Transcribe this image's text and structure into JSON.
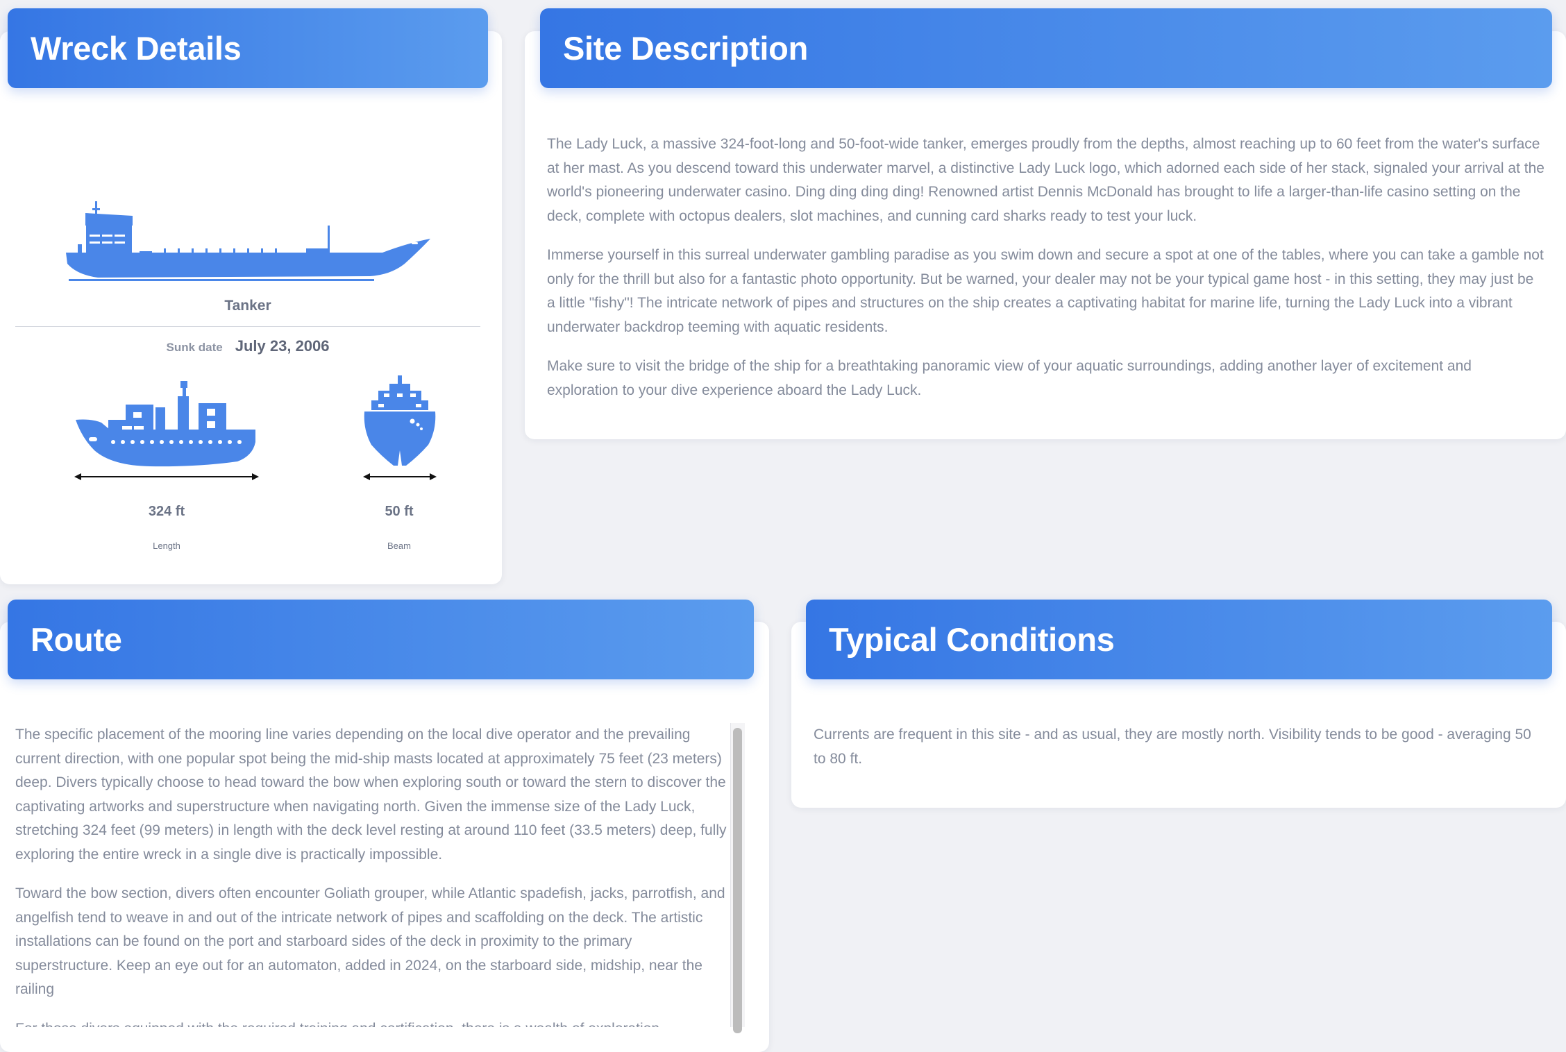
{
  "wreck_details": {
    "title": "Wreck Details",
    "ship_type": "Tanker",
    "sunk_date_label": "Sunk date",
    "sunk_date": "July 23, 2006",
    "length_value": "324 ft",
    "length_label": "Length",
    "beam_value": "50 ft",
    "beam_label": "Beam"
  },
  "site_description": {
    "title": "Site Description",
    "paragraphs": [
      "The Lady Luck, a massive 324-foot-long and 50-foot-wide tanker, emerges proudly from the depths, almost reaching up to 60 feet from the water's surface at her mast. As you descend toward this underwater marvel, a distinctive Lady Luck logo, which adorned each side of her stack, signaled your arrival at the world's pioneering underwater casino. Ding ding ding ding! Renowned artist Dennis McDonald has brought to life a larger-than-life casino setting on the deck, complete with octopus dealers, slot machines, and cunning card sharks ready to test your luck.",
      "Immerse yourself in this surreal underwater gambling paradise as you swim down and secure a spot at one of the tables, where you can take a gamble not only for the thrill but also for a fantastic photo opportunity. But be warned, your dealer may not be your typical game host - in this setting, they may just be a little \"fishy\"! The intricate network of pipes and structures on the ship creates a captivating habitat for marine life, turning the Lady Luck into a vibrant underwater backdrop teeming with aquatic residents.",
      "Make sure to visit the bridge of the ship for a breathtaking panoramic view of your aquatic surroundings, adding another layer of excitement and exploration to your dive experience aboard the Lady Luck."
    ]
  },
  "route": {
    "title": "Route",
    "paragraphs": [
      "The specific placement of the mooring line varies depending on the local dive operator and the prevailing current direction, with one popular spot being the mid-ship masts located at approximately 75 feet (23 meters) deep. Divers typically choose to head toward the bow when exploring south or toward the stern to discover the captivating artworks and superstructure when navigating north. Given the immense size of the Lady Luck, stretching 324 feet (99 meters) in length with the deck level resting at around 110 feet (33.5 meters) deep, fully exploring the entire wreck in a single dive is practically impossible.",
      "Toward the bow section, divers often encounter Goliath grouper, while Atlantic spadefish, jacks, parrotfish, and angelfish tend to weave in and out of the intricate network of pipes and scaffolding on the deck. The artistic installations can be found on the port and starboard sides of the deck in proximity to the primary superstructure. Keep an eye out for an automaton, added in 2024, on the starboard side, midship, near the railing",
      "For those divers equipped with the required training and certification, there is a wealth of exploration"
    ]
  },
  "typical_conditions": {
    "title": "Typical Conditions",
    "text": "Currents are frequent in this site - and as usual, they are mostly north. Visibility tends to be good - averaging 50 to 80 ft."
  },
  "colors": {
    "accent": "#3d7fe8",
    "banner_start": "#3576e4",
    "banner_end": "#5b9cee",
    "icon": "#4a86e8"
  },
  "icons": [
    "tanker-ship-icon",
    "ship-side-icon",
    "ship-front-icon",
    "length-arrow-icon",
    "beam-arrow-icon"
  ]
}
